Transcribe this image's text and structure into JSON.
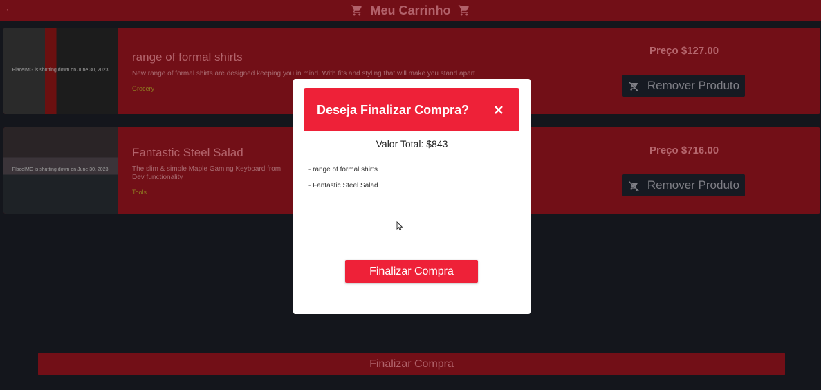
{
  "header": {
    "title": "Meu Carrinho"
  },
  "products": [
    {
      "name": "range of formal shirts",
      "description": "New range of formal shirts are designed keeping you in mind. With fits and styling that will make you stand apart",
      "category": "Grocery",
      "price": "Preço $127.00",
      "remove_label": "Remover Produto",
      "image_caption": "PlaceIMG is shutting down on June 30, 2023."
    },
    {
      "name": "Fantastic Steel Salad",
      "description": "The slim & simple Maple Gaming Keyboard from Dev functionality",
      "category": "Tools",
      "price": "Preço $716.00",
      "remove_label": "Remover Produto",
      "image_caption": "PlaceIMG is shutting down on June 30, 2023."
    }
  ],
  "bottom_button": "Finalizar Compra",
  "modal": {
    "title": "Deseja Finalizar Compra?",
    "total": "Valor Total: $843",
    "items": [
      "- range of formal shirts",
      "- Fantastic Steel Salad"
    ],
    "finalize_label": "Finalizar Compra"
  },
  "colors": {
    "accent": "#ee2138",
    "dim_accent": "#720f17",
    "background": "#14161c"
  }
}
